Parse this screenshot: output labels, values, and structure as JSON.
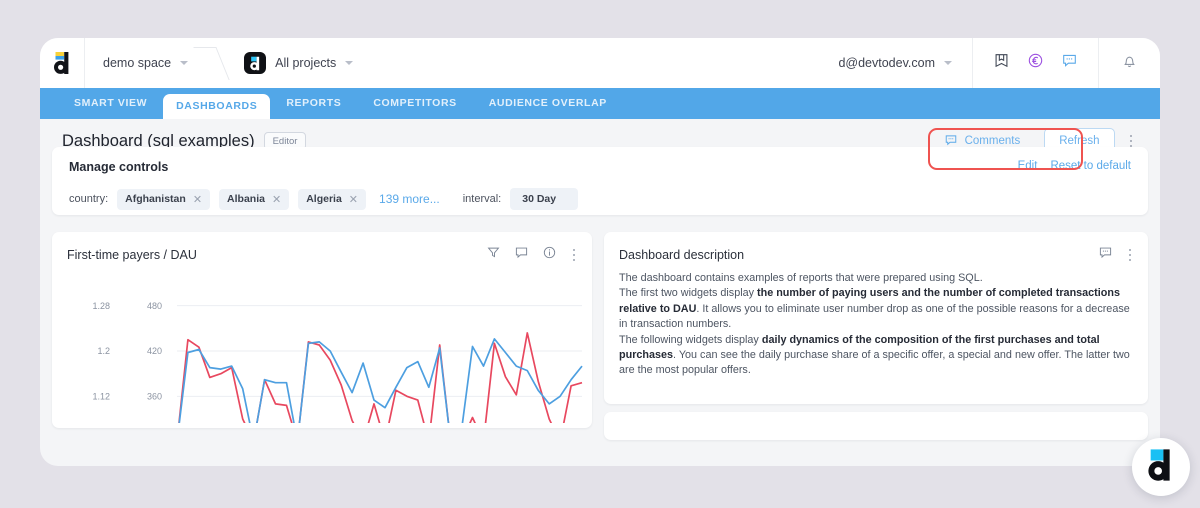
{
  "topbar": {
    "brand_icon": "devtodev-logo-icon",
    "space_name": "demo space",
    "space_chevron": "chevron-down-icon",
    "project_badge_icon": "devtodev-project-icon",
    "project_name": "All projects",
    "project_chevron": "chevron-down-icon",
    "account_email": "d@devtodev.com",
    "account_chevron": "chevron-down-icon",
    "icons": [
      {
        "name": "bookmark-icon",
        "title": "Knowledge base"
      },
      {
        "name": "euro-icon",
        "title": "Billing"
      },
      {
        "name": "chat-icon",
        "title": "Messages"
      },
      {
        "name": "bell-icon",
        "title": "Notifications"
      }
    ]
  },
  "nav": {
    "tabs": [
      {
        "label": "SMART VIEW",
        "active": false
      },
      {
        "label": "DASHBOARDS",
        "active": true
      },
      {
        "label": "REPORTS",
        "active": false
      },
      {
        "label": "COMPETITORS",
        "active": false
      },
      {
        "label": "AUDIENCE OVERLAP",
        "active": false
      }
    ]
  },
  "title_row": {
    "title": "Dashboard (sql examples)",
    "role_badge": "Editor",
    "comments_button": "Comments",
    "comments_icon": "comment-icon",
    "refresh_button": "Refresh",
    "kebab_icon": "more-vertical-icon",
    "highlight_color": "#ef5350"
  },
  "controls": {
    "title": "Manage controls",
    "edit_link": "Edit",
    "reset_link": "Reset to default",
    "country_label": "country:",
    "countries": [
      "Afghanistan",
      "Albania",
      "Algeria"
    ],
    "remove_icon": "close-icon",
    "more_label": "139 more...",
    "interval_label": "interval:",
    "interval_value": "30 Day"
  },
  "widget_chart": {
    "title": "First-time payers / DAU",
    "icons": [
      {
        "name": "filter-icon"
      },
      {
        "name": "comment-icon"
      },
      {
        "name": "info-icon"
      },
      {
        "name": "more-vertical-icon"
      }
    ]
  },
  "widget_description": {
    "title": "Dashboard description",
    "icons": [
      {
        "name": "comment-icon"
      },
      {
        "name": "more-vertical-icon"
      }
    ],
    "paragraphs": [
      [
        {
          "t": "The dashboard contains examples of reports that were prepared using SQL.",
          "b": false
        }
      ],
      [
        {
          "t": "The first two widgets display ",
          "b": false
        },
        {
          "t": "the number of paying users and the number of completed transactions relative to DAU",
          "b": true
        },
        {
          "t": ". It allows you to eliminate user number drop as one of the possible reasons for a decrease in transaction numbers.",
          "b": false
        }
      ],
      [
        {
          "t": "The following widgets display ",
          "b": false
        },
        {
          "t": "daily dynamics of the composition of the first purchases and total purchases",
          "b": true
        },
        {
          "t": ". You can see the daily purchase share of a specific offer, a special and new offer. The latter two are the most popular offers.",
          "b": false
        }
      ]
    ]
  },
  "fab": {
    "icon": "devtodev-chat-logo-icon"
  },
  "colors": {
    "nav_blue": "#52a7e8",
    "accent_blue": "#5aa9e9",
    "series_blue": "#4d9fe0",
    "series_red": "#e8485f",
    "page_bg": "#e3e1e8",
    "highlight_red": "#ef5350"
  },
  "chart_data": {
    "type": "line",
    "title": "First-time payers / DAU",
    "xlabel": "",
    "ylabel": "",
    "grid": true,
    "legend": "none",
    "axes": [
      {
        "side": "left",
        "ticks": [
          "1.28",
          "1.2",
          "1.12"
        ],
        "ylim": [
          1.08,
          1.32
        ]
      },
      {
        "side": "left-secondary",
        "ticks": [
          "480",
          "420",
          "360"
        ],
        "ylim": [
          330,
          510
        ]
      }
    ],
    "series": [
      {
        "name": "First-time payers",
        "color": "#e8485f",
        "values": [
          300,
          435,
          425,
          385,
          390,
          398,
          330,
          300,
          382,
          350,
          348,
          300,
          432,
          428,
          408,
          375,
          328,
          300,
          350,
          300,
          368,
          360,
          355,
          300,
          428,
          300,
          300,
          332,
          300,
          430,
          386,
          362,
          444,
          380,
          330,
          300,
          374,
          378
        ]
      },
      {
        "name": "DAU",
        "color": "#4d9fe0",
        "values": [
          300,
          418,
          422,
          398,
          396,
          400,
          370,
          300,
          382,
          378,
          378,
          300,
          430,
          432,
          420,
          392,
          365,
          404,
          355,
          345,
          372,
          398,
          406,
          372,
          424,
          300,
          316,
          426,
          400,
          436,
          418,
          400,
          394,
          368,
          350,
          360,
          382,
          400
        ]
      }
    ]
  }
}
